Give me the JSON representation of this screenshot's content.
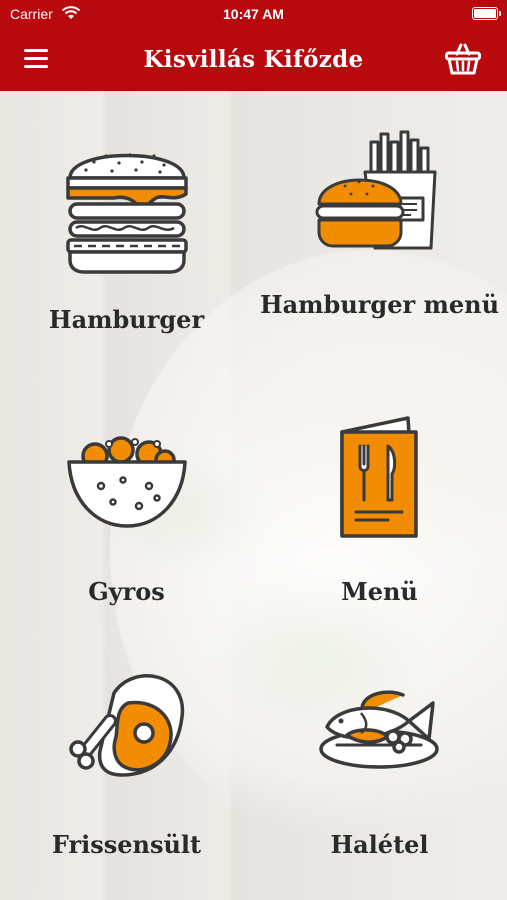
{
  "status_bar": {
    "carrier": "Carrier",
    "time": "10:47 AM"
  },
  "header": {
    "title": "Kisvillás Kifőzde",
    "menu_icon": "hamburger-menu-icon",
    "cart_icon": "basket-icon"
  },
  "categories": [
    {
      "label": "Hamburger",
      "icon": "burger-icon"
    },
    {
      "label": "Hamburger menü",
      "icon": "burger-fries-icon"
    },
    {
      "label": "Gyros",
      "icon": "gyros-bowl-icon"
    },
    {
      "label": "Menü",
      "icon": "menu-card-icon"
    },
    {
      "label": "Frissensült",
      "icon": "chicken-leg-icon"
    },
    {
      "label": "Halétel",
      "icon": "fish-plate-icon"
    }
  ],
  "colors": {
    "brand_red": "#b8090f",
    "accent_orange": "#f28c00",
    "outline_dark": "#3a3a3a"
  }
}
